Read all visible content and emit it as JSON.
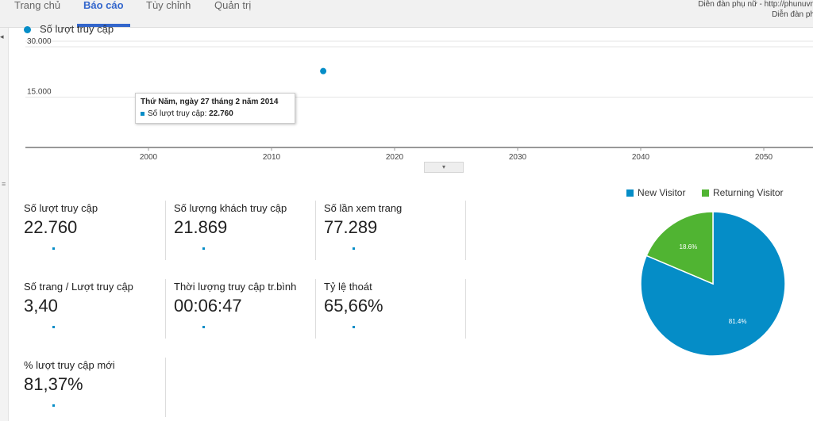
{
  "nav": {
    "tabs": [
      {
        "label": "Trang chủ"
      },
      {
        "label": "Báo cáo"
      },
      {
        "label": "Tùy chỉnh"
      },
      {
        "label": "Quản trị"
      }
    ],
    "active_tab": "Báo cáo",
    "site_line1": "Diễn đàn phụ nữ - http://phunuvn",
    "site_line2": "Diễn đàn ph"
  },
  "chart_data": {
    "type": "scatter",
    "series": [
      {
        "name": "Số lượt truy cập",
        "x": [
          2014.2
        ],
        "y": [
          22760
        ],
        "color": "#058dc7"
      }
    ],
    "y_ticks": [
      {
        "value": 15000,
        "label": "15.000"
      },
      {
        "value": 30000,
        "label": "30.000"
      }
    ],
    "x_ticks": [
      {
        "value": 2000,
        "label": "2000"
      },
      {
        "value": 2010,
        "label": "2010"
      },
      {
        "value": 2020,
        "label": "2020"
      },
      {
        "value": 2030,
        "label": "2030"
      },
      {
        "value": 2040,
        "label": "2040"
      },
      {
        "value": 2050,
        "label": "2050"
      }
    ],
    "xlim": [
      1990,
      2054
    ],
    "ylim": [
      0,
      34500
    ],
    "grid": true,
    "legend": "top-left"
  },
  "tooltip": {
    "title": "Thứ Năm, ngày 27 tháng 2 năm 2014",
    "label": "Số lượt truy cập: ",
    "value": "22.760"
  },
  "expander_icon": "▾",
  "metrics": [
    {
      "label": "Số lượt truy cập",
      "value": "22.760"
    },
    {
      "label": "Số lượng khách truy cập",
      "value": "21.869"
    },
    {
      "label": "Số lần xem trang",
      "value": "77.289"
    },
    {
      "label": "Số trang / Lượt truy cập",
      "value": "3,40"
    },
    {
      "label": "Thời lượng truy cập tr.bình",
      "value": "00:06:47"
    },
    {
      "label": "Tỷ lệ thoát",
      "value": "65,66%"
    },
    {
      "label": "% lượt truy cập mới",
      "value": "81,37%"
    }
  ],
  "pie": {
    "type": "pie",
    "slices": [
      {
        "name": "New Visitor",
        "value": 81.4,
        "label": "81.4%",
        "color": "#058dc7"
      },
      {
        "name": "Returning Visitor",
        "value": 18.6,
        "label": "18.6%",
        "color": "#50b432"
      }
    ]
  },
  "rail": {
    "toggle_icon": "◂",
    "handle_icon": "≡"
  }
}
